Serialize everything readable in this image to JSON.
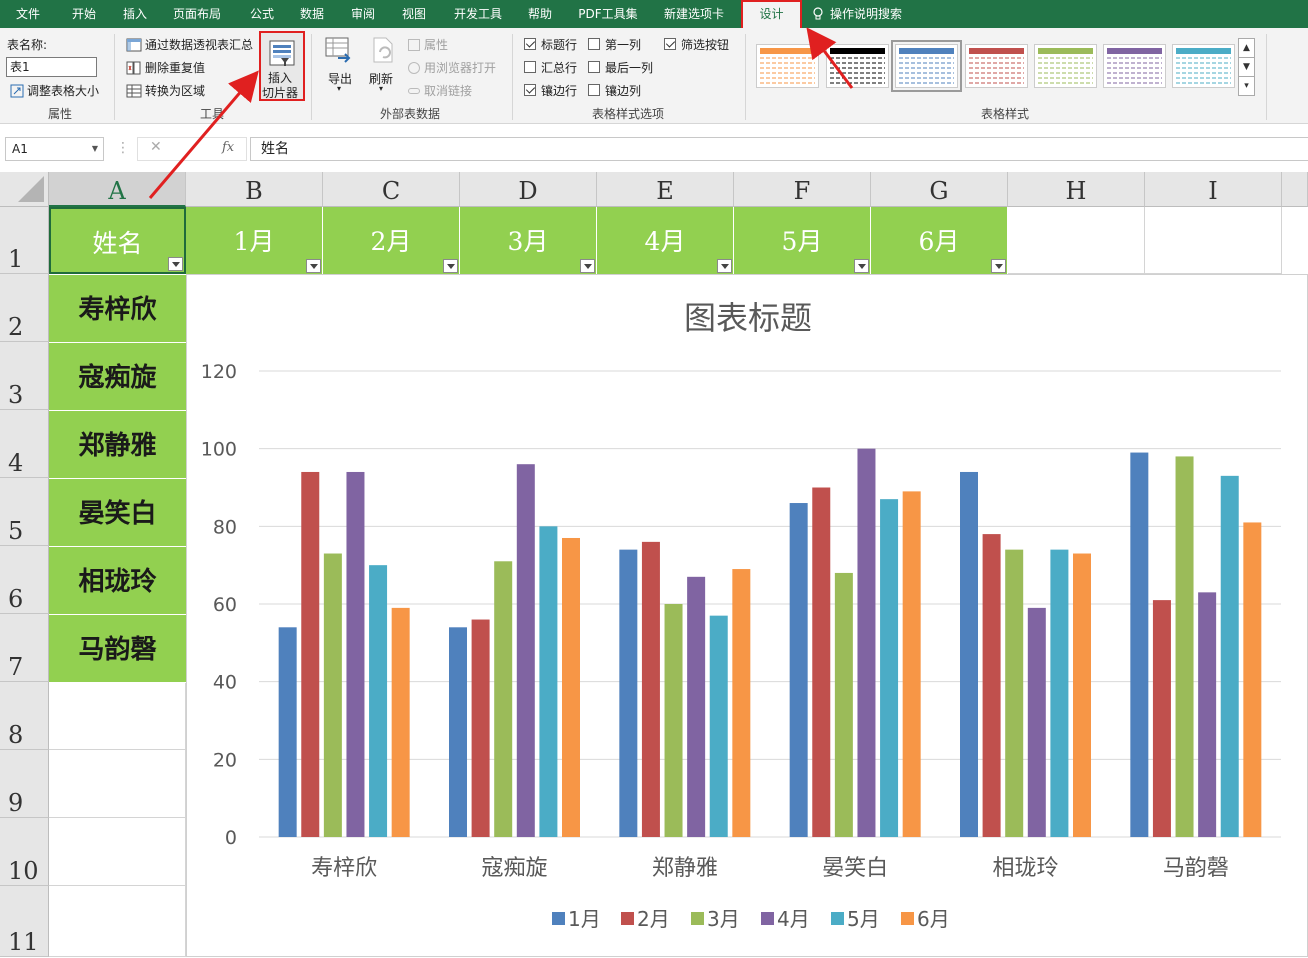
{
  "tabs": [
    "文件",
    "开始",
    "插入",
    "页面布局",
    "公式",
    "数据",
    "审阅",
    "视图",
    "开发工具",
    "帮助",
    "PDF工具集",
    "新建选项卡",
    "设计",
    "操作说明搜索"
  ],
  "active_tab": "设计",
  "ribbon": {
    "properties": {
      "table_name_label": "表名称:",
      "table_name_value": "表1",
      "resize_label": "调整表格大小",
      "group_label": "属性"
    },
    "tools": {
      "pivot_summary": "通过数据透视表汇总",
      "remove_duplicates": "删除重复值",
      "convert_range": "转换为区域",
      "insert_slicer": [
        "插入",
        "切片器"
      ],
      "group_label": "工具"
    },
    "external": {
      "export": "导出",
      "refresh": "刷新",
      "properties": "属性",
      "open_browser": "用浏览器打开",
      "unlink": "取消链接",
      "group_label": "外部表数据"
    },
    "style_options": {
      "header_row": "标题行",
      "first_column": "第一列",
      "filter_button": "筛选按钮",
      "total_row": "汇总行",
      "last_column": "最后一列",
      "banded_rows": "镶边行",
      "banded_columns": "镶边列",
      "checked": {
        "header_row": true,
        "first_column": false,
        "filter_button": true,
        "total_row": false,
        "last_column": false,
        "banded_rows": true,
        "banded_columns": false
      },
      "group_label": "表格样式选项"
    },
    "styles": {
      "group_label": "表格样式",
      "swatch_colors": [
        "#f79646",
        "#000000",
        "#4f81bd",
        "#c0504d",
        "#9bbb59",
        "#8064a2",
        "#4bacc6"
      ]
    }
  },
  "formula_bar": {
    "name_box": "A1",
    "fx": "fx",
    "content": "姓名"
  },
  "columns": [
    "A",
    "B",
    "C",
    "D",
    "E",
    "F",
    "G",
    "H",
    "I"
  ],
  "rows": [
    "1",
    "2",
    "3",
    "4",
    "5",
    "6",
    "7",
    "8",
    "9",
    "10",
    "11"
  ],
  "table": {
    "headers": [
      "姓名",
      "1月",
      "2月",
      "3月",
      "4月",
      "5月",
      "6月"
    ],
    "names": [
      "寿梓欣",
      "寇痴旋",
      "郑静雅",
      "晏笑白",
      "相珑玲",
      "马韵磬"
    ]
  },
  "chart_data": {
    "type": "bar",
    "title": "图表标题",
    "categories": [
      "寿梓欣",
      "寇痴旋",
      "郑静雅",
      "晏笑白",
      "相珑玲",
      "马韵磬"
    ],
    "ylim": [
      0,
      120
    ],
    "yticks": [
      0,
      20,
      40,
      60,
      80,
      100,
      120
    ],
    "grid": true,
    "legend": "bottom",
    "series": [
      {
        "name": "1月",
        "color": "#4f81bd",
        "values": [
          54,
          54,
          74,
          86,
          94,
          99
        ]
      },
      {
        "name": "2月",
        "color": "#c0504d",
        "values": [
          94,
          56,
          76,
          90,
          78,
          61
        ]
      },
      {
        "name": "3月",
        "color": "#9bbb59",
        "values": [
          73,
          71,
          60,
          68,
          74,
          98
        ]
      },
      {
        "name": "4月",
        "color": "#8064a2",
        "values": [
          94,
          96,
          67,
          100,
          59,
          63
        ]
      },
      {
        "name": "5月",
        "color": "#4bacc6",
        "values": [
          70,
          80,
          57,
          87,
          74,
          93
        ]
      },
      {
        "name": "6月",
        "color": "#f79646",
        "values": [
          59,
          77,
          69,
          89,
          73,
          81
        ]
      }
    ]
  },
  "colors": {
    "excel_green": "#217346",
    "table_fill": "#92d050",
    "annotation_red": "#e02020"
  }
}
